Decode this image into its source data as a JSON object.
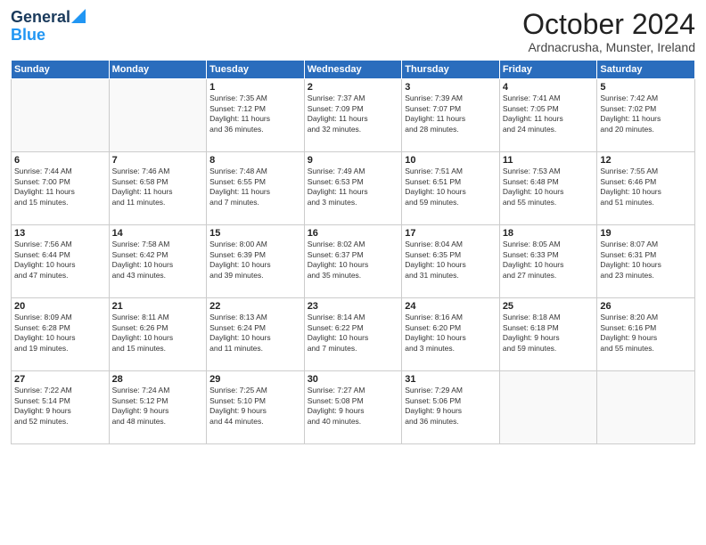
{
  "header": {
    "logo_line1": "General",
    "logo_line2": "Blue",
    "month": "October 2024",
    "location": "Ardnacrusha, Munster, Ireland"
  },
  "weekdays": [
    "Sunday",
    "Monday",
    "Tuesday",
    "Wednesday",
    "Thursday",
    "Friday",
    "Saturday"
  ],
  "weeks": [
    [
      {
        "day": "",
        "text": ""
      },
      {
        "day": "",
        "text": ""
      },
      {
        "day": "1",
        "text": "Sunrise: 7:35 AM\nSunset: 7:12 PM\nDaylight: 11 hours\nand 36 minutes."
      },
      {
        "day": "2",
        "text": "Sunrise: 7:37 AM\nSunset: 7:09 PM\nDaylight: 11 hours\nand 32 minutes."
      },
      {
        "day": "3",
        "text": "Sunrise: 7:39 AM\nSunset: 7:07 PM\nDaylight: 11 hours\nand 28 minutes."
      },
      {
        "day": "4",
        "text": "Sunrise: 7:41 AM\nSunset: 7:05 PM\nDaylight: 11 hours\nand 24 minutes."
      },
      {
        "day": "5",
        "text": "Sunrise: 7:42 AM\nSunset: 7:02 PM\nDaylight: 11 hours\nand 20 minutes."
      }
    ],
    [
      {
        "day": "6",
        "text": "Sunrise: 7:44 AM\nSunset: 7:00 PM\nDaylight: 11 hours\nand 15 minutes."
      },
      {
        "day": "7",
        "text": "Sunrise: 7:46 AM\nSunset: 6:58 PM\nDaylight: 11 hours\nand 11 minutes."
      },
      {
        "day": "8",
        "text": "Sunrise: 7:48 AM\nSunset: 6:55 PM\nDaylight: 11 hours\nand 7 minutes."
      },
      {
        "day": "9",
        "text": "Sunrise: 7:49 AM\nSunset: 6:53 PM\nDaylight: 11 hours\nand 3 minutes."
      },
      {
        "day": "10",
        "text": "Sunrise: 7:51 AM\nSunset: 6:51 PM\nDaylight: 10 hours\nand 59 minutes."
      },
      {
        "day": "11",
        "text": "Sunrise: 7:53 AM\nSunset: 6:48 PM\nDaylight: 10 hours\nand 55 minutes."
      },
      {
        "day": "12",
        "text": "Sunrise: 7:55 AM\nSunset: 6:46 PM\nDaylight: 10 hours\nand 51 minutes."
      }
    ],
    [
      {
        "day": "13",
        "text": "Sunrise: 7:56 AM\nSunset: 6:44 PM\nDaylight: 10 hours\nand 47 minutes."
      },
      {
        "day": "14",
        "text": "Sunrise: 7:58 AM\nSunset: 6:42 PM\nDaylight: 10 hours\nand 43 minutes."
      },
      {
        "day": "15",
        "text": "Sunrise: 8:00 AM\nSunset: 6:39 PM\nDaylight: 10 hours\nand 39 minutes."
      },
      {
        "day": "16",
        "text": "Sunrise: 8:02 AM\nSunset: 6:37 PM\nDaylight: 10 hours\nand 35 minutes."
      },
      {
        "day": "17",
        "text": "Sunrise: 8:04 AM\nSunset: 6:35 PM\nDaylight: 10 hours\nand 31 minutes."
      },
      {
        "day": "18",
        "text": "Sunrise: 8:05 AM\nSunset: 6:33 PM\nDaylight: 10 hours\nand 27 minutes."
      },
      {
        "day": "19",
        "text": "Sunrise: 8:07 AM\nSunset: 6:31 PM\nDaylight: 10 hours\nand 23 minutes."
      }
    ],
    [
      {
        "day": "20",
        "text": "Sunrise: 8:09 AM\nSunset: 6:28 PM\nDaylight: 10 hours\nand 19 minutes."
      },
      {
        "day": "21",
        "text": "Sunrise: 8:11 AM\nSunset: 6:26 PM\nDaylight: 10 hours\nand 15 minutes."
      },
      {
        "day": "22",
        "text": "Sunrise: 8:13 AM\nSunset: 6:24 PM\nDaylight: 10 hours\nand 11 minutes."
      },
      {
        "day": "23",
        "text": "Sunrise: 8:14 AM\nSunset: 6:22 PM\nDaylight: 10 hours\nand 7 minutes."
      },
      {
        "day": "24",
        "text": "Sunrise: 8:16 AM\nSunset: 6:20 PM\nDaylight: 10 hours\nand 3 minutes."
      },
      {
        "day": "25",
        "text": "Sunrise: 8:18 AM\nSunset: 6:18 PM\nDaylight: 9 hours\nand 59 minutes."
      },
      {
        "day": "26",
        "text": "Sunrise: 8:20 AM\nSunset: 6:16 PM\nDaylight: 9 hours\nand 55 minutes."
      }
    ],
    [
      {
        "day": "27",
        "text": "Sunrise: 7:22 AM\nSunset: 5:14 PM\nDaylight: 9 hours\nand 52 minutes."
      },
      {
        "day": "28",
        "text": "Sunrise: 7:24 AM\nSunset: 5:12 PM\nDaylight: 9 hours\nand 48 minutes."
      },
      {
        "day": "29",
        "text": "Sunrise: 7:25 AM\nSunset: 5:10 PM\nDaylight: 9 hours\nand 44 minutes."
      },
      {
        "day": "30",
        "text": "Sunrise: 7:27 AM\nSunset: 5:08 PM\nDaylight: 9 hours\nand 40 minutes."
      },
      {
        "day": "31",
        "text": "Sunrise: 7:29 AM\nSunset: 5:06 PM\nDaylight: 9 hours\nand 36 minutes."
      },
      {
        "day": "",
        "text": ""
      },
      {
        "day": "",
        "text": ""
      }
    ]
  ]
}
